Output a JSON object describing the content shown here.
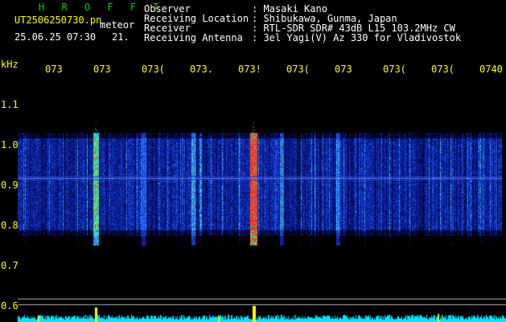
{
  "header": {
    "program_name": "H R O F F T",
    "file_name": "UT2506250730.pn",
    "mode_label": "meteor",
    "date_time": "25.06.25 07:30",
    "count": "21.",
    "info": [
      {
        "label": "Observer",
        "value": ": Masaki Kano"
      },
      {
        "label": "Receiving Location",
        "value": ": Shibukawa, Gunma, Japan"
      },
      {
        "label": "Receiver",
        "value": ": RTL-SDR SDR# 43dB L15 103.2MHz CW"
      },
      {
        "label": "Receiving Antenna",
        "value": ": 3el Yagi(V) Az 330 for Vladivostok"
      }
    ]
  },
  "axis": {
    "unit": "kHz",
    "freq_ticks": [
      "1.1",
      "1.0",
      "0.9",
      "0.8",
      "0.7",
      "0.6"
    ],
    "time_ticks": [
      "073",
      "073",
      "073(",
      "073.",
      "073!",
      "073(",
      "073",
      "073(",
      "073(",
      "0740"
    ]
  },
  "colors": {
    "background": "#000000",
    "header_text": "#ffffff",
    "axis_text": "#ffff00",
    "program_name": "#00d000",
    "noise_floor": "#00e5ff",
    "meteor_spike": "#ffff00"
  }
}
